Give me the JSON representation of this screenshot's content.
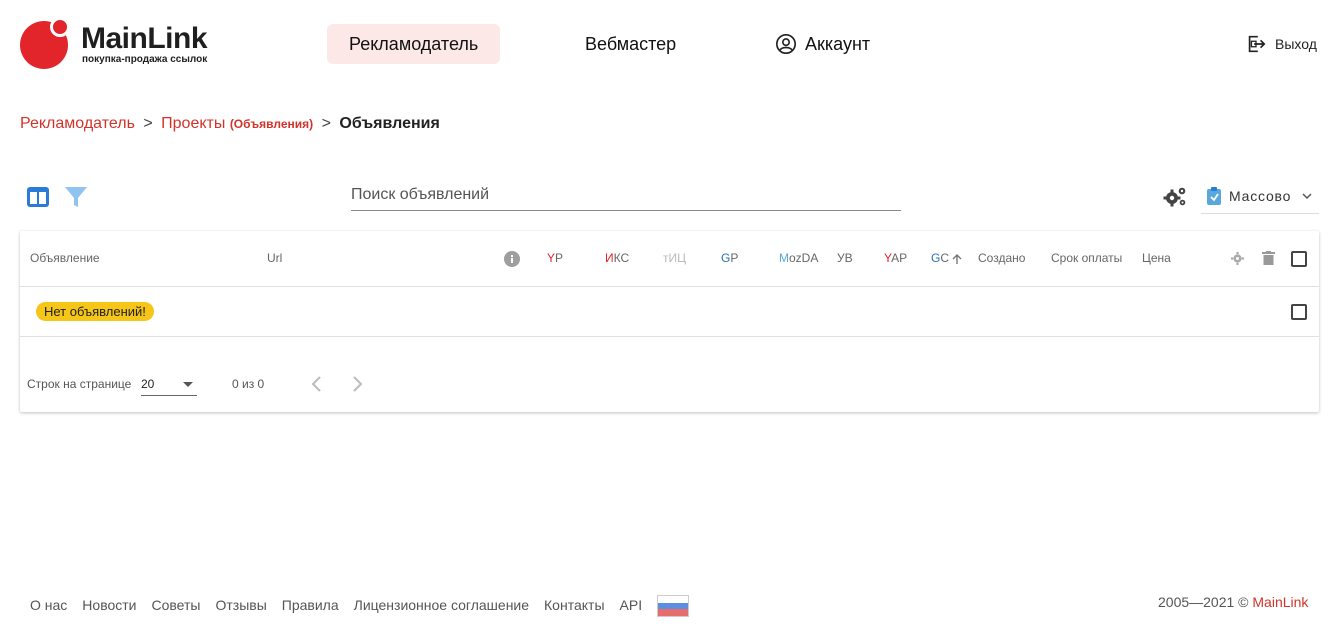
{
  "header": {
    "logo_text": "MainLink",
    "logo_sub": "покупка-продажа ссылок",
    "nav": {
      "advertiser": "Рекламодатель",
      "webmaster": "Вебмастер",
      "account": "Аккаунт"
    },
    "logout": "Выход"
  },
  "breadcrumb": {
    "item1": "Рекламодатель",
    "sep1": ">",
    "item2": "Проекты",
    "item2_sub": "(Объявления)",
    "sep2": ">",
    "current": "Объявления"
  },
  "toolbar": {
    "search_placeholder": "Поиск объявлений",
    "bulk_label": "Массово"
  },
  "table": {
    "columns": {
      "ad": "Объявление",
      "url": "Url",
      "yr_first": "Y",
      "yr_rest": "P",
      "iks_first": "И",
      "iks_rest": "КС",
      "tic": "тИЦ",
      "gp_first": "G",
      "gp_rest": "P",
      "moz_first": "M",
      "moz_rest": "ozDA",
      "uv": "УВ",
      "yap_first": "Y",
      "yap_rest": "AP",
      "gc_first": "G",
      "gc_rest": "C",
      "created": "Создано",
      "term": "Срок оплаты",
      "price": "Цена"
    },
    "empty_badge": "Нет объявлений!"
  },
  "pagination": {
    "rows_label": "Строк на странице",
    "rows_value": "20",
    "count": "0 из 0"
  },
  "footer": {
    "links": [
      "О нас",
      "Новости",
      "Советы",
      "Отзывы",
      "Правила",
      "Лицензионное соглашение",
      "Контакты",
      "API"
    ],
    "copyright": "2005—2021 ©",
    "brand": "MainLink"
  },
  "colors": {
    "brand_red": "#e1252b",
    "nav_active_bg": "#fbe8e7",
    "badge_yellow": "#f5c518",
    "flag_white": "#ffffff",
    "flag_blue": "#2f6fd6",
    "flag_red": "#e1252b"
  }
}
